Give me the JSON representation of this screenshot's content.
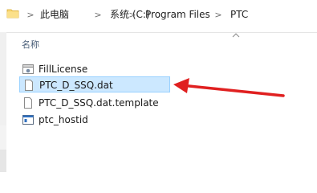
{
  "address_bar": {
    "breadcrumbs": [
      "此电脑",
      "系统 (C:)",
      "Program Files",
      "PTC"
    ],
    "separator": ">"
  },
  "file_list": {
    "column_name": "名称",
    "items": [
      {
        "name": "FillLicense",
        "icon": "shortcut-file-icon",
        "selected": false
      },
      {
        "name": "PTC_D_SSQ.dat",
        "icon": "document-icon",
        "selected": true
      },
      {
        "name": "PTC_D_SSQ.dat.template",
        "icon": "document-icon",
        "selected": false
      },
      {
        "name": "ptc_hostid",
        "icon": "app-window-icon",
        "selected": false
      }
    ]
  },
  "annotation": {
    "arrow_color": "#e02020",
    "points_to": "PTC_D_SSQ.dat"
  },
  "colors": {
    "selection_bg": "#cce8ff",
    "selection_border": "#99d1ff",
    "header_text": "#4c607a"
  }
}
